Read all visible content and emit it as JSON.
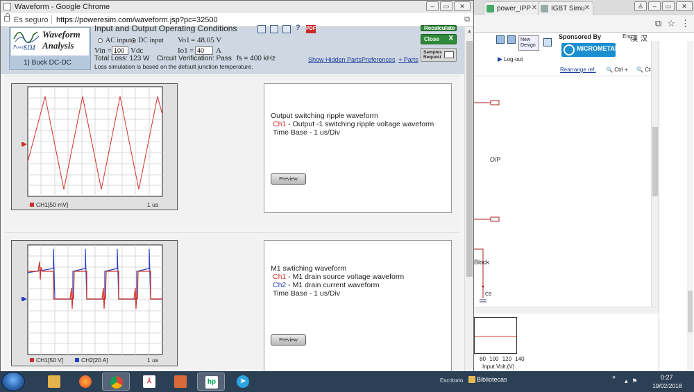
{
  "popup": {
    "window_title": "Waveform - Google Chrome",
    "secure_label": "Es seguro",
    "url": "https://poweresim.com/waveform.jsp?pc=32500"
  },
  "header": {
    "logo_title_line1": "Waveform",
    "logo_title_line2": "Analysis",
    "logo_power": "Power",
    "logo_sim": "SIM",
    "logo_subtitle": "1) Buck DC-DC",
    "conditions_title": "Input and Output Operating Conditions",
    "ac_input_label": "AC input",
    "dc_input_label": "DC input",
    "selected_input": "dc",
    "vin_label": "Vin =",
    "vin_value": "100",
    "vin_unit": "Vdc",
    "vo1_label": "Vo1",
    "vo1_value": "= 48.05 V",
    "io1_label": "Io1",
    "io1_eq": "=",
    "io1_value": "40",
    "io1_unit": "A",
    "total_loss": "Total Loss: 123 W",
    "verification": "Circuit Verification: Pass",
    "fs": "fs = 400 kHz",
    "links": {
      "show_hidden": "Show Hidden Parts",
      "preferences": "Preferences",
      "parts": "+ Parts"
    },
    "loss_note": "Loss simulation is based on the default junction temperature.",
    "recalculate_label": "Recalculate",
    "close_label": "Close",
    "close_x": "X",
    "samples_label_1": "Samples",
    "samples_label_2": "Request",
    "pdf_label": "PDF",
    "help_label": "?"
  },
  "panels": [
    {
      "title": "Output switching ripple waveform",
      "lines": [
        {
          "ch": "Ch1",
          "text": " - Output -1 switching ripple voltage waveform"
        }
      ],
      "timebase": "Time Base - 1 us/Div",
      "preview_label": "Preview",
      "scope_legend": [
        {
          "label": "CH1[50 mV]",
          "color": "#d0302a"
        }
      ],
      "scope_timebase": "1 us",
      "ch1_color": "#d0302a",
      "ch2_color": "#2a3fbf"
    },
    {
      "title": "M1 swtiching waveform",
      "lines": [
        {
          "ch": "Ch1",
          "text": " - M1 drain source voltage waveform"
        },
        {
          "ch": "Ch2",
          "text": " - M1 drain current waveform"
        }
      ],
      "timebase": "Time Base - 1 us/Div",
      "preview_label": "Preview",
      "scope_legend": [
        {
          "label": "CH1[50 V]",
          "color": "#d0302a"
        },
        {
          "label": "CH2[20 A]",
          "color": "#2a3fbf"
        }
      ],
      "scope_timebase": "1 us"
    }
  ],
  "background_browser": {
    "tabs": [
      "power_IPP",
      "IGBT Simu"
    ],
    "new_design_label": "New Design",
    "sponsored_by": "Sponsored By",
    "eng_label": "Eng",
    "cn_label_1": "漢",
    "cn_label_2": "汉",
    "micrometals_label": "MICROMETALS",
    "logout_label": "Log-out",
    "rearrange_label": "Rearrange ref.",
    "ctrl_plus_label": "Ctrl +",
    "ctrl_minus_label": "Ctrl -",
    "schematic_labels": {
      "op": "O/P",
      "block": "Block",
      "c9": "C9"
    },
    "mini_plot_ticks": "80 100 120 140",
    "mini_plot_xlabel": "Input Volt.(V)"
  },
  "taskbar": {
    "apps": [
      "file-explorer",
      "firefox",
      "chrome",
      "pdf-reader",
      "toolbox",
      "hp-app",
      "telegram"
    ],
    "escritorio_label": "Escritorio",
    "bibliotecas_label": "Bibliotecas",
    "chevron": "»",
    "time": "0:27",
    "date": "19/02/2018"
  }
}
